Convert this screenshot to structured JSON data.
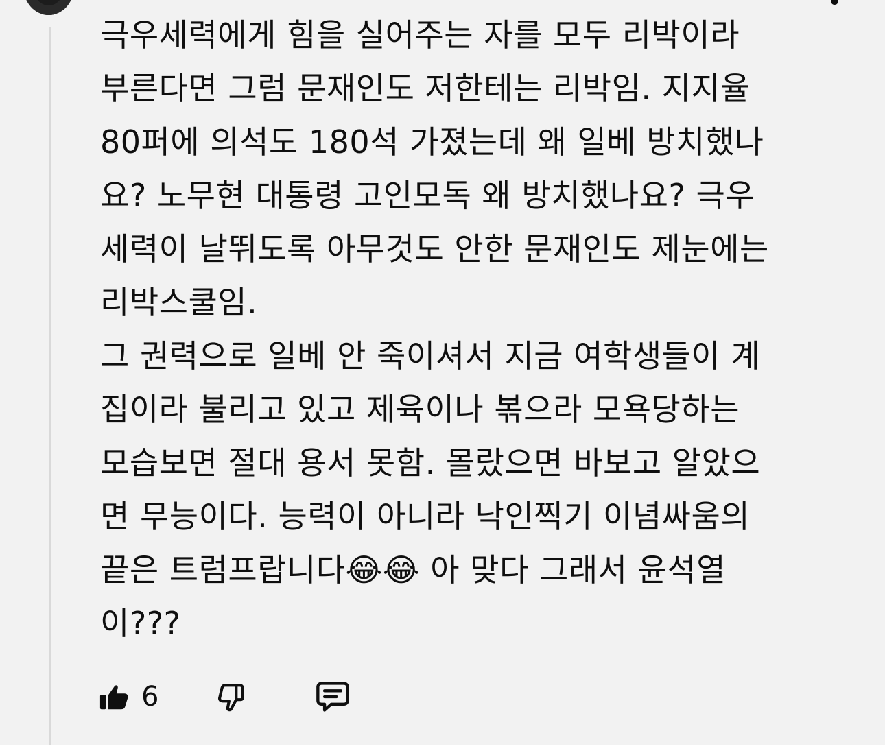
{
  "comment": {
    "lines": [
      "극우세력에게 힘을 실어주는 자를 모두 리박이라",
      "부른다면 그럼 문재인도 저한테는 리박임. 지지율",
      "80퍼에 의석도 180석 가졌는데 왜 일베 방치했나",
      "요? 노무현 대통령  고인모독 왜 방치했나요? 극우",
      "세력이 날뛰도록 아무것도 안한 문재인도 제눈에는",
      "리박스쿨임.",
      "그 권력으로 일베 안 죽이셔서 지금 여학생들이 계",
      "집이라 불리고 있고 제육이나 볶으라 모욕당하는",
      "모습보면 절대 용서 못함. 몰랐으면 바보고 알았으",
      "면 무능이다. 능력이 아니라 낙인찍기 이념싸움의",
      "끝은 트럼프랍니다😂😂 아 맞다 그래서 윤석열",
      "이???"
    ]
  },
  "actions": {
    "like_count": "6",
    "like_icon": "thumbs-up-filled-icon",
    "dislike_icon": "thumbs-down-outline-icon",
    "reply_icon": "comment-bubble-icon"
  },
  "colors": {
    "background": "#f2f2f2",
    "text": "#0f0f0f",
    "thread_line": "#d9d9d9"
  }
}
